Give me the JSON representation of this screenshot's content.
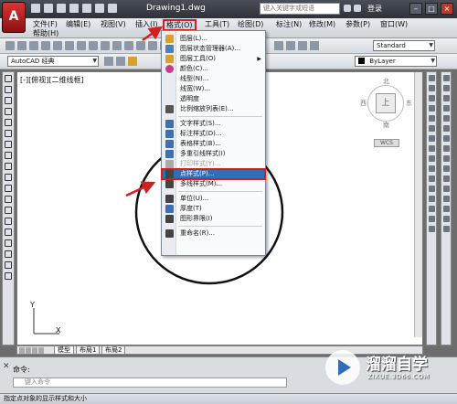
{
  "app": {
    "logo_letter": "A",
    "document_title": "Drawing1.dwg",
    "search_placeholder": "键入关键字或短语",
    "login_label": "登录",
    "window_controls": {
      "minimize": "–",
      "maximize": "□",
      "close": "×"
    }
  },
  "menubar": {
    "items": [
      {
        "label": "文件(F)"
      },
      {
        "label": "编辑(E)"
      },
      {
        "label": "视图(V)"
      },
      {
        "label": "插入(I)"
      },
      {
        "label": "格式(O)"
      },
      {
        "label": "工具(T)"
      },
      {
        "label": "绘图(D)"
      },
      {
        "label": "标注(N)"
      },
      {
        "label": "修改(M)"
      },
      {
        "label": "参数(P)"
      },
      {
        "label": "窗口(W)"
      },
      {
        "label": "帮助(H)"
      }
    ],
    "active_index": 4
  },
  "toolbar2": {
    "workspace": "AutoCAD 经典",
    "text_style": "Standard",
    "layer_color": "ByLayer"
  },
  "canvas": {
    "viewport_label": "[-][俯视][二维线框]",
    "viewcube": {
      "north": "北",
      "south": "南",
      "east": "东",
      "west": "西",
      "face": "上",
      "wcs": "WCS"
    },
    "ucs": {
      "x": "X",
      "y": "Y"
    }
  },
  "format_menu": {
    "items": [
      {
        "label": "图层(L)...",
        "icon": "layers-icon",
        "color": "#d9a12b"
      },
      {
        "label": "图层状态管理器(A)...",
        "icon": "layer-state-icon",
        "color": "#4b7fc1"
      },
      {
        "label": "图层工具(O)",
        "icon": "layer-tools-icon",
        "color": "#d9a12b",
        "submenu": true
      },
      {
        "label": "颜色(C)...",
        "icon": "color-wheel-icon",
        "color": "#c93b8e"
      },
      {
        "label": "线型(N)...",
        "icon": "",
        "color": ""
      },
      {
        "label": "线宽(W)...",
        "icon": "",
        "color": ""
      },
      {
        "label": "透明度",
        "icon": "",
        "color": ""
      },
      {
        "label": "比例缩放列表(E)...",
        "icon": "scale-list-icon",
        "color": "#555555"
      },
      {
        "label": "文字样式(S)...",
        "icon": "text-style-icon",
        "color": "#3c6fb3"
      },
      {
        "label": "标注样式(D)...",
        "icon": "dim-style-icon",
        "color": "#3c6fb3"
      },
      {
        "label": "表格样式(B)...",
        "icon": "table-style-icon",
        "color": "#3c6fb3"
      },
      {
        "label": "多重引线样式(I)",
        "icon": "mleader-style-icon",
        "color": "#3c6fb3"
      },
      {
        "label": "打印样式(Y)...",
        "icon": "plot-style-icon",
        "color": "#aaaaaa",
        "disabled": true
      },
      {
        "label": "点样式(P)...",
        "icon": "point-style-icon",
        "color": "#444444",
        "highlight": true
      },
      {
        "label": "多线样式(M)...",
        "icon": "mline-style-icon",
        "color": "#444444"
      },
      {
        "label": "单位(U)...",
        "icon": "units-icon",
        "color": "#444444"
      },
      {
        "label": "厚度(T)",
        "icon": "thickness-icon",
        "color": "#3c6fb3"
      },
      {
        "label": "图形界限(I)",
        "icon": "limits-icon",
        "color": "#444444"
      },
      {
        "label": "重命名(R)...",
        "icon": "rename-icon",
        "color": "#444444"
      }
    ]
  },
  "layout_tabs": [
    {
      "label": "模型",
      "active": true
    },
    {
      "label": "布局1",
      "active": false
    },
    {
      "label": "布局2",
      "active": false
    }
  ],
  "command": {
    "prompt": "命令:",
    "input_placeholder": "键入命令"
  },
  "status_text": "指定点对象的显示样式和大小",
  "watermark": {
    "title": "溜溜自学",
    "url": "ZIXUE.3D66.COM"
  },
  "colors": {
    "highlight_blue": "#2f6fb6",
    "annotation_red": "#d21f1f"
  }
}
